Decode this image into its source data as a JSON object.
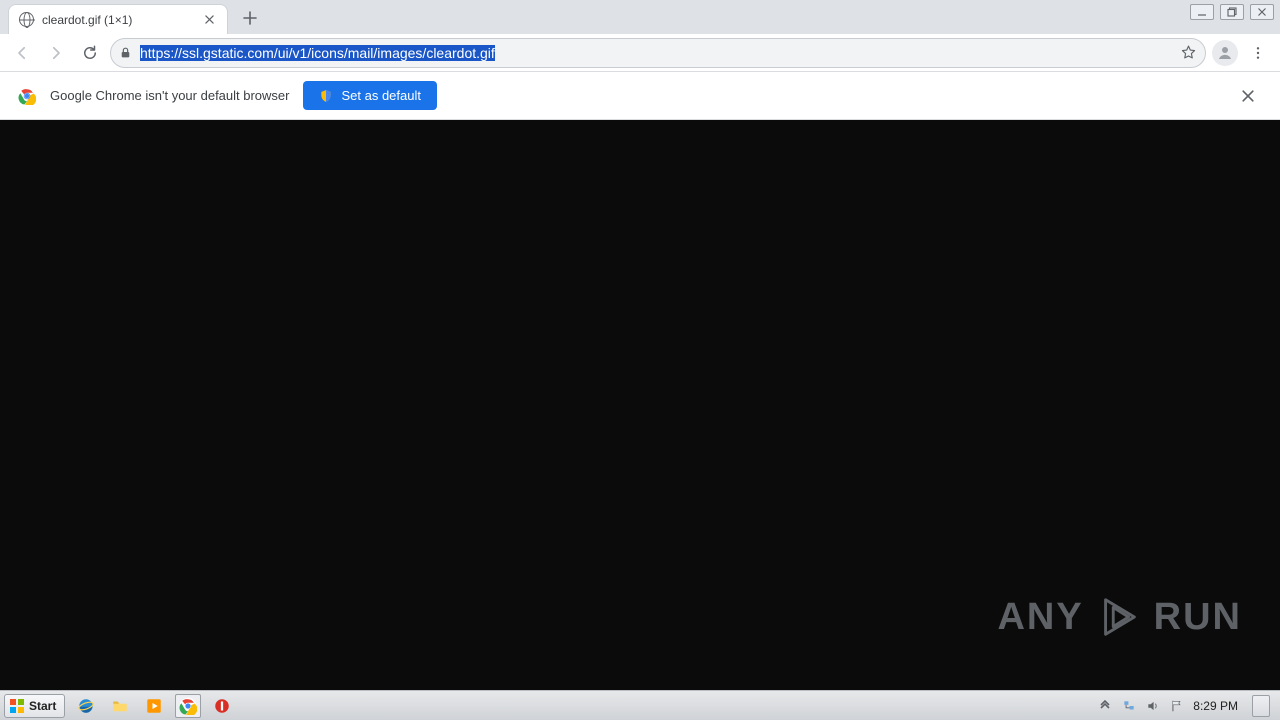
{
  "tab": {
    "title": "cleardot.gif (1×1)"
  },
  "omnibox": {
    "url": "https://ssl.gstatic.com/ui/v1/icons/mail/images/cleardot.gif"
  },
  "infobar": {
    "message": "Google Chrome isn't your default browser",
    "button_label": "Set as default"
  },
  "watermark": {
    "left": "ANY",
    "right": "RUN"
  },
  "taskbar": {
    "start_label": "Start",
    "clock": "8:29 PM"
  }
}
